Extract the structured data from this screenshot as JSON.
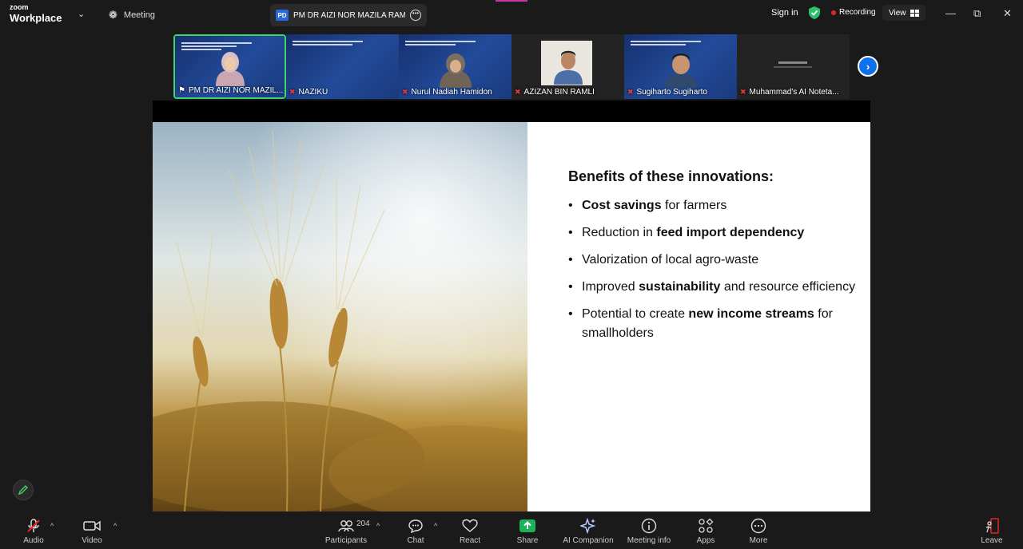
{
  "app": {
    "brand_line1": "zoom",
    "brand_line2": "Workplace"
  },
  "titlebar": {
    "meeting_label": "Meeting",
    "share_badge": "PD",
    "share_name": "PM DR AIZI NOR MAZILA RAMLI'",
    "sign_in": "Sign in",
    "recording": "Recording",
    "view": "View"
  },
  "participants": [
    {
      "name": "PM DR AIZI NOR MAZIL...",
      "muted": false,
      "active": true
    },
    {
      "name": "NAZIKU",
      "muted": true,
      "active": false
    },
    {
      "name": "Nurul Nadiah Hamidon",
      "muted": true,
      "active": false
    },
    {
      "name": "AZIZAN BIN RAMLI",
      "muted": true,
      "active": false
    },
    {
      "name": "Sugiharto Sugiharto",
      "muted": true,
      "active": false
    },
    {
      "name": "Muhammad's AI Noteta...",
      "muted": true,
      "active": false
    }
  ],
  "slide": {
    "title": "Benefits of these innovations:",
    "bullets": [
      {
        "pre": "",
        "bold": "Cost savings",
        "post": " for farmers"
      },
      {
        "pre": "Reduction in ",
        "bold": "feed import dependency",
        "post": ""
      },
      {
        "pre": "Valorization of local agro-waste",
        "bold": "",
        "post": ""
      },
      {
        "pre": "Improved ",
        "bold": "sustainability",
        "post": " and resource efficiency"
      },
      {
        "pre": "Potential to create ",
        "bold": "new income streams",
        "post": " for smallholders"
      }
    ]
  },
  "toolbar": {
    "audio": "Audio",
    "video": "Video",
    "participants": "Participants",
    "participant_count": "204",
    "chat": "Chat",
    "react": "React",
    "share": "Share",
    "ai_companion": "AI Companion",
    "meeting_info": "Meeting info",
    "apps": "Apps",
    "more": "More",
    "leave": "Leave"
  },
  "colors": {
    "accent_green": "#3fd36d",
    "share_green": "#19b35a",
    "zoom_blue": "#0e71eb",
    "record_red": "#e02828"
  }
}
